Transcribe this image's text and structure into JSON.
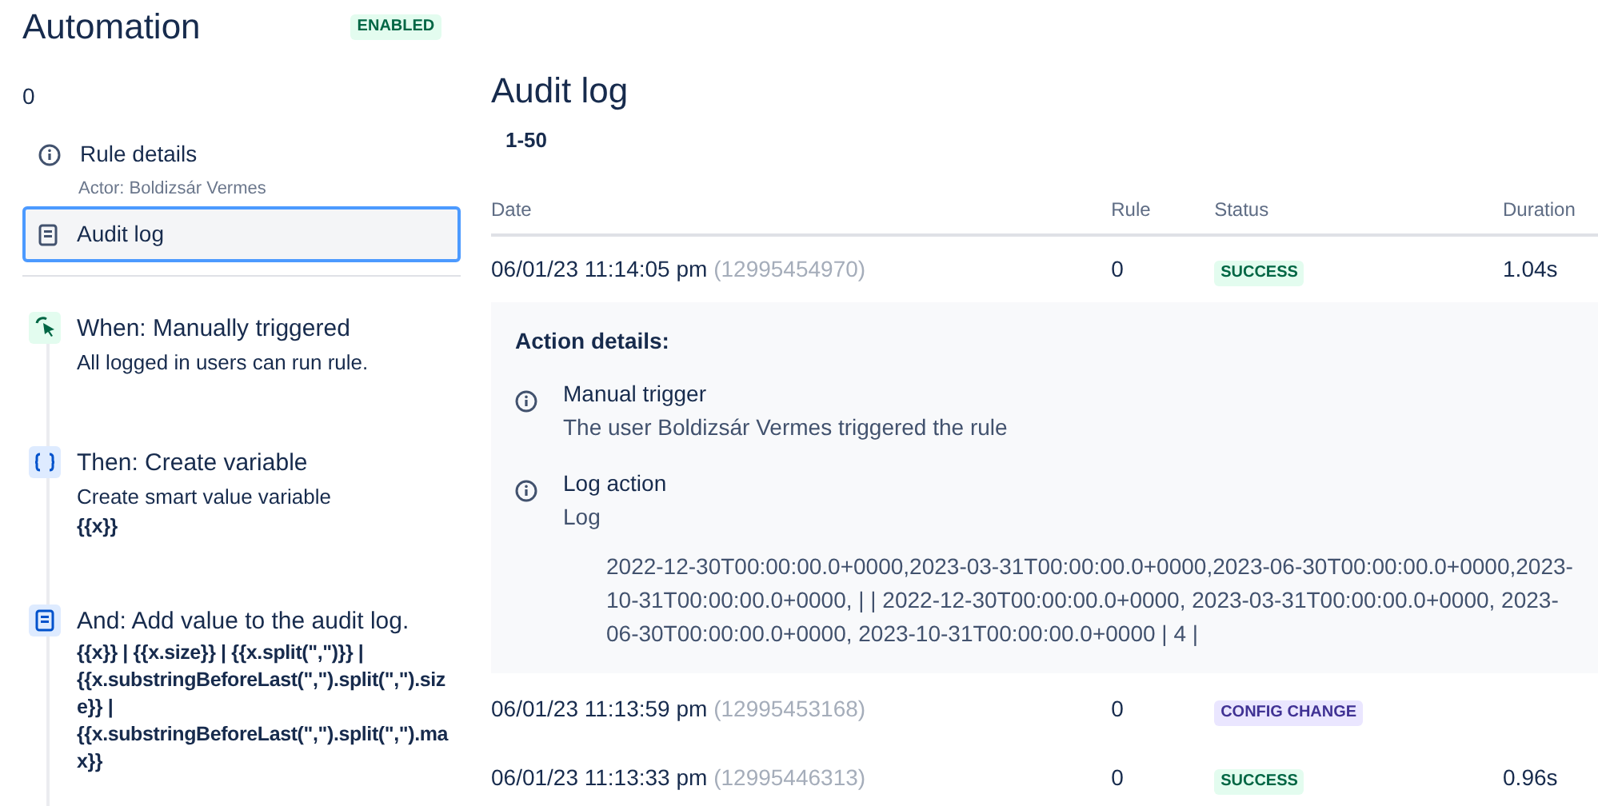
{
  "header": {
    "title": "Automation",
    "badge": "ENABLED"
  },
  "rule_name": "0",
  "nav": [
    {
      "kind": "info",
      "label": "Rule details",
      "sub": "Actor: Boldizsár Vermes",
      "selected": false
    },
    {
      "kind": "log",
      "label": "Audit log",
      "selected": true
    }
  ],
  "steps": [
    {
      "kind": "trigger",
      "title": "When: Manually triggered",
      "lines": [
        "All logged in users can run rule."
      ]
    },
    {
      "kind": "variable",
      "title": "Then: Create variable",
      "lines": [
        "Create smart value variable"
      ],
      "code": "{{x}}"
    },
    {
      "kind": "log",
      "title": "And: Add value to the audit log.",
      "code": "{{x}} | {{x.size}} | {{x.split(\",\")}} | {{x.substringBeforeLast(\",\").split(\",\").size}} | {{x.substringBeforeLast(\",\").split(\",\").max}}"
    }
  ],
  "audit": {
    "title": "Audit log",
    "range": "1-50",
    "columns": [
      "Date",
      "Rule",
      "Status",
      "Duration"
    ],
    "rows": [
      {
        "date": "06/01/23 11:14:05 pm",
        "id": "(12995454970)",
        "rule": "0",
        "status": {
          "label": "SUCCESS",
          "kind": "success"
        },
        "duration": "1.04s",
        "details": {
          "title": "Action details:",
          "items": [
            {
              "title": "Manual trigger",
              "text": "The user Boldizsár Vermes triggered the rule"
            },
            {
              "title": "Log action",
              "text": "Log",
              "log": "2022-12-30T00:00:00.0+0000,2023-03-31T00:00:00.0+0000,2023-06-30T00:00:00.0+0000,2023-10-31T00:00:00.0+0000, | | 2022-12-30T00:00:00.0+0000, 2023-03-31T00:00:00.0+0000, 2023-06-30T00:00:00.0+0000, 2023-10-31T00:00:00.0+0000 | 4 |"
            }
          ]
        }
      },
      {
        "date": "06/01/23 11:13:59 pm",
        "id": "(12995453168)",
        "rule": "0",
        "status": {
          "label": "CONFIG CHANGE",
          "kind": "config"
        }
      },
      {
        "date": "06/01/23 11:13:33 pm",
        "id": "(12995446313)",
        "rule": "0",
        "status": {
          "label": "SUCCESS",
          "kind": "success"
        },
        "duration": "0.96s"
      }
    ]
  }
}
